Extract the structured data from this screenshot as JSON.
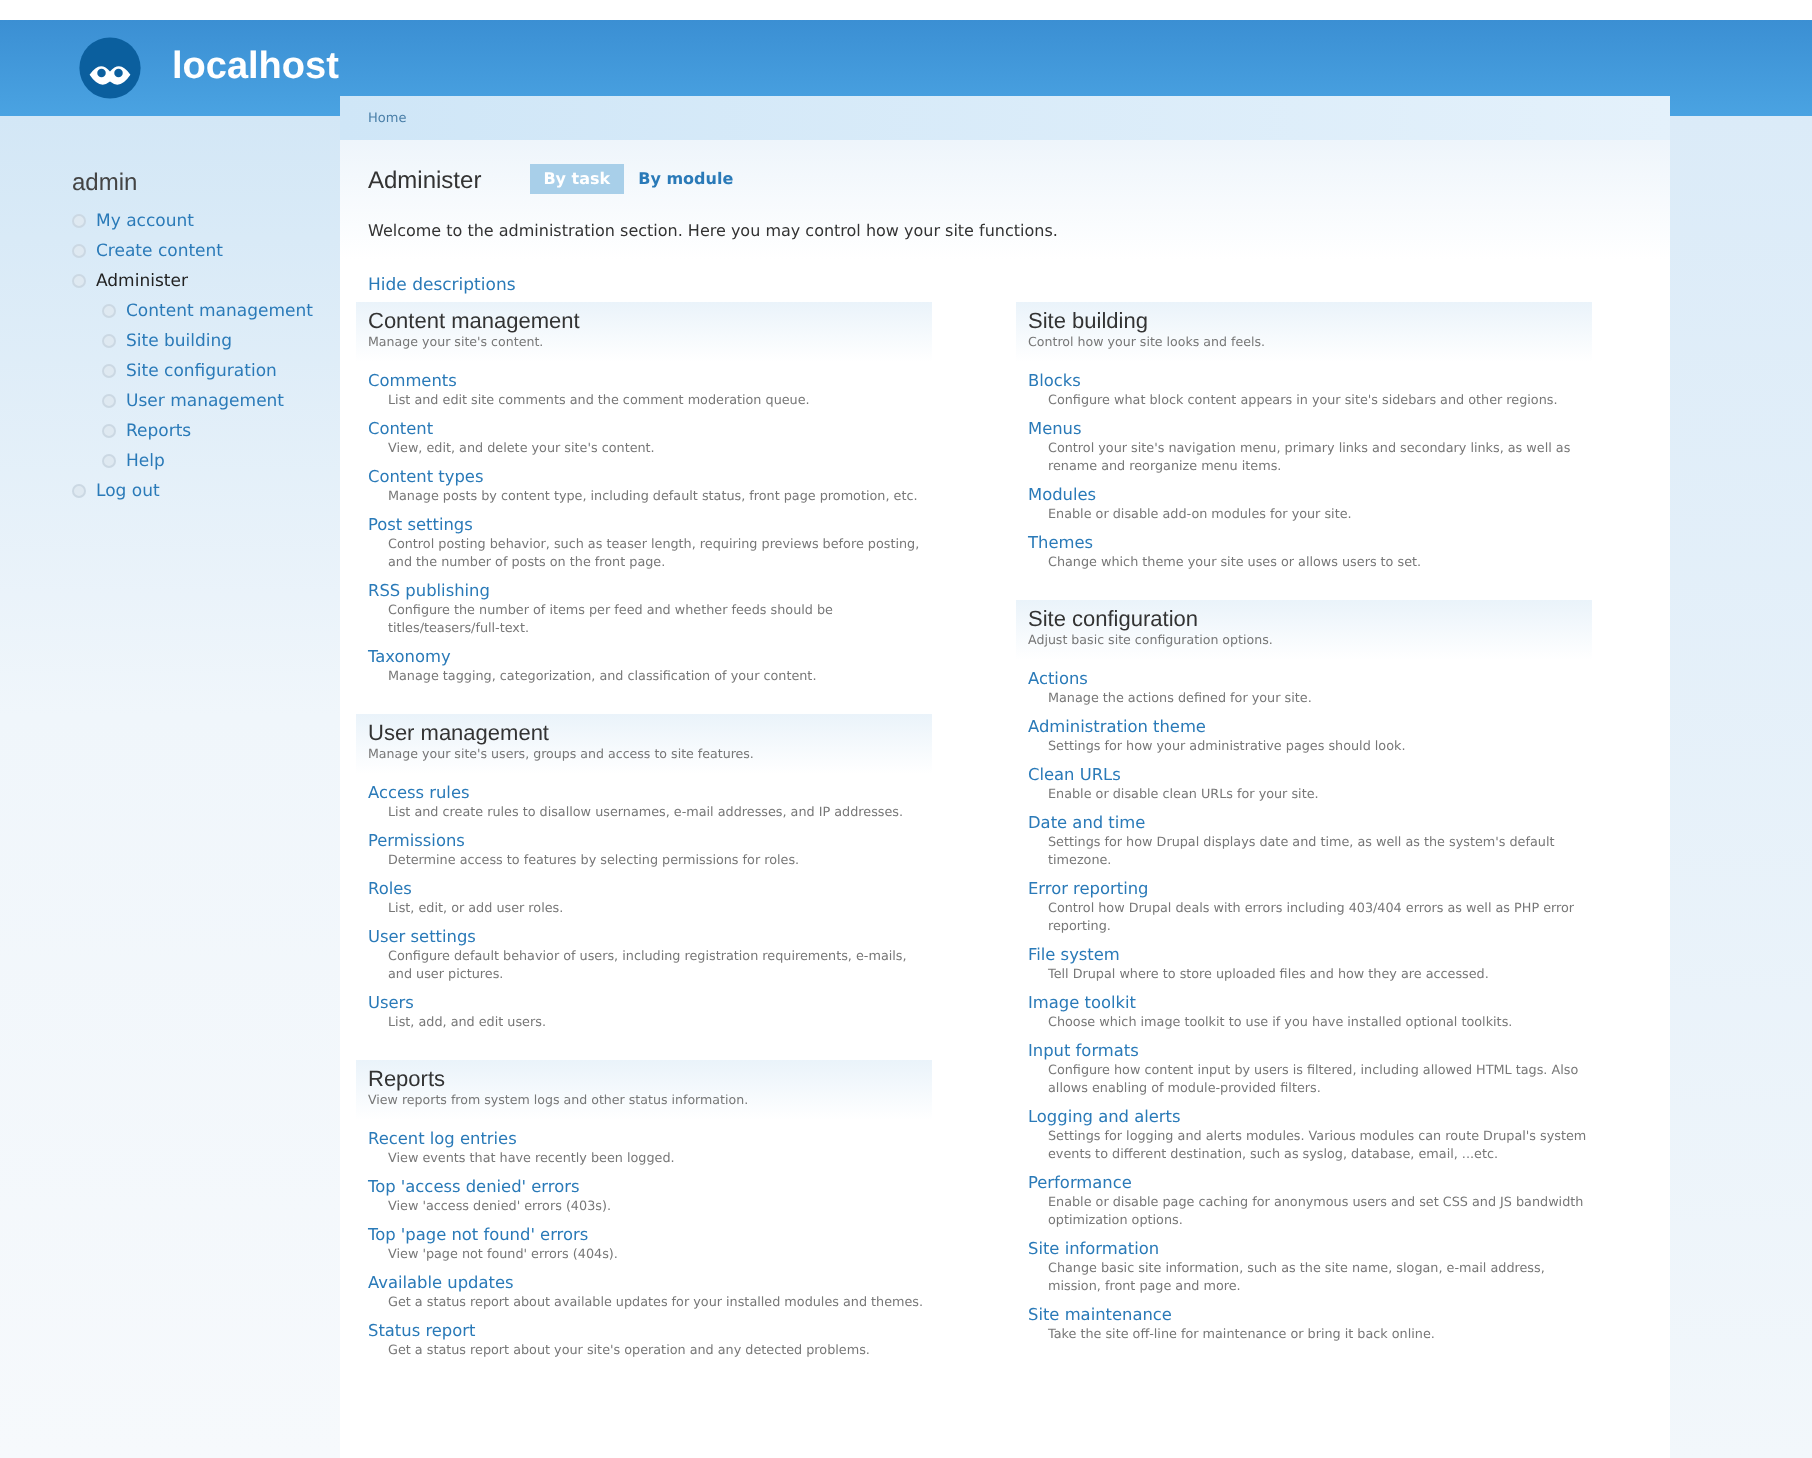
{
  "site": {
    "name": "localhost"
  },
  "breadcrumb": [
    "Home"
  ],
  "sidebar": {
    "title": "admin",
    "items": [
      {
        "label": "My account",
        "active": false
      },
      {
        "label": "Create content",
        "active": false
      },
      {
        "label": "Administer",
        "active": true,
        "children": [
          {
            "label": "Content management",
            "active": false
          },
          {
            "label": "Site building",
            "active": false
          },
          {
            "label": "Site configuration",
            "active": false
          },
          {
            "label": "User management",
            "active": false
          },
          {
            "label": "Reports",
            "active": false
          },
          {
            "label": "Help",
            "active": false
          }
        ]
      },
      {
        "label": "Log out",
        "active": false
      }
    ]
  },
  "page": {
    "title": "Administer",
    "tabs": [
      {
        "label": "By task",
        "selected": true
      },
      {
        "label": "By module",
        "selected": false
      }
    ],
    "intro": "Welcome to the administration section. Here you may control how your site functions.",
    "toggle_link": "Hide descriptions"
  },
  "columns": [
    [
      {
        "title": "Content management",
        "description": "Manage your site's content.",
        "items": [
          {
            "link": "Comments",
            "description": "List and edit site comments and the comment moderation queue."
          },
          {
            "link": "Content",
            "description": "View, edit, and delete your site's content."
          },
          {
            "link": "Content types",
            "description": "Manage posts by content type, including default status, front page promotion, etc."
          },
          {
            "link": "Post settings",
            "description": "Control posting behavior, such as teaser length, requiring previews before posting, and the number of posts on the front page."
          },
          {
            "link": "RSS publishing",
            "description": "Configure the number of items per feed and whether feeds should be titles/teasers/full-text."
          },
          {
            "link": "Taxonomy",
            "description": "Manage tagging, categorization, and classification of your content."
          }
        ]
      },
      {
        "title": "User management",
        "description": "Manage your site's users, groups and access to site features.",
        "items": [
          {
            "link": "Access rules",
            "description": "List and create rules to disallow usernames, e-mail addresses, and IP addresses."
          },
          {
            "link": "Permissions",
            "description": "Determine access to features by selecting permissions for roles."
          },
          {
            "link": "Roles",
            "description": "List, edit, or add user roles."
          },
          {
            "link": "User settings",
            "description": "Configure default behavior of users, including registration requirements, e-mails, and user pictures."
          },
          {
            "link": "Users",
            "description": "List, add, and edit users."
          }
        ]
      },
      {
        "title": "Reports",
        "description": "View reports from system logs and other status information.",
        "items": [
          {
            "link": "Recent log entries",
            "description": "View events that have recently been logged."
          },
          {
            "link": "Top 'access denied' errors",
            "description": "View 'access denied' errors (403s)."
          },
          {
            "link": "Top 'page not found' errors",
            "description": "View 'page not found' errors (404s)."
          },
          {
            "link": "Available updates",
            "description": "Get a status report about available updates for your installed modules and themes."
          },
          {
            "link": "Status report",
            "description": "Get a status report about your site's operation and any detected problems."
          }
        ]
      }
    ],
    [
      {
        "title": "Site building",
        "description": "Control how your site looks and feels.",
        "items": [
          {
            "link": "Blocks",
            "description": "Configure what block content appears in your site's sidebars and other regions."
          },
          {
            "link": "Menus",
            "description": "Control your site's navigation menu, primary links and secondary links, as well as rename and reorganize menu items."
          },
          {
            "link": "Modules",
            "description": "Enable or disable add-on modules for your site."
          },
          {
            "link": "Themes",
            "description": "Change which theme your site uses or allows users to set."
          }
        ]
      },
      {
        "title": "Site configuration",
        "description": "Adjust basic site configuration options.",
        "items": [
          {
            "link": "Actions",
            "description": "Manage the actions defined for your site."
          },
          {
            "link": "Administration theme",
            "description": "Settings for how your administrative pages should look."
          },
          {
            "link": "Clean URLs",
            "description": "Enable or disable clean URLs for your site."
          },
          {
            "link": "Date and time",
            "description": "Settings for how Drupal displays date and time, as well as the system's default timezone."
          },
          {
            "link": "Error reporting",
            "description": "Control how Drupal deals with errors including 403/404 errors as well as PHP error reporting."
          },
          {
            "link": "File system",
            "description": "Tell Drupal where to store uploaded files and how they are accessed."
          },
          {
            "link": "Image toolkit",
            "description": "Choose which image toolkit to use if you have installed optional toolkits."
          },
          {
            "link": "Input formats",
            "description": "Configure how content input by users is filtered, including allowed HTML tags. Also allows enabling of module-provided filters."
          },
          {
            "link": "Logging and alerts",
            "description": "Settings for logging and alerts modules. Various modules can route Drupal's system events to different destination, such as syslog, database, email, ...etc."
          },
          {
            "link": "Performance",
            "description": "Enable or disable page caching for anonymous users and set CSS and JS bandwidth optimization options."
          },
          {
            "link": "Site information",
            "description": "Change basic site information, such as the site name, slogan, e-mail address, mission, front page and more."
          },
          {
            "link": "Site maintenance",
            "description": "Take the site off-line for maintenance or bring it back online."
          }
        ]
      }
    ]
  ]
}
